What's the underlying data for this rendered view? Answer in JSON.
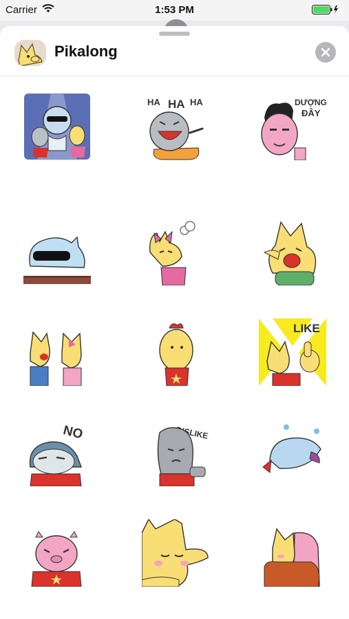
{
  "status_bar": {
    "carrier": "Carrier",
    "time": "1:53 PM",
    "wifi_icon": "wifi-icon",
    "battery_icon": "battery-charging-icon"
  },
  "header": {
    "app_name": "Pikalong",
    "app_icon": "pikalong-app-icon",
    "close_icon": "close-icon"
  },
  "stickers": [
    {
      "name": "disco-dance-sticker"
    },
    {
      "name": "laughing-sticker",
      "caption": [
        "HA",
        "HA",
        "HA"
      ]
    },
    {
      "name": "pink-man-sticker",
      "caption": [
        "DƯỢNG",
        "ĐÂY"
      ]
    },
    {
      "name": "shark-sunglasses-sticker"
    },
    {
      "name": "angry-bow-sticker"
    },
    {
      "name": "crying-sticker"
    },
    {
      "name": "shouting-sticker"
    },
    {
      "name": "chicken-sticker"
    },
    {
      "name": "like-sticker",
      "caption": [
        "LIKE"
      ]
    },
    {
      "name": "no-sticker",
      "caption": [
        "NO"
      ]
    },
    {
      "name": "dislike-sticker",
      "caption": [
        "DISLIKE"
      ]
    },
    {
      "name": "dolphin-sticker"
    },
    {
      "name": "pig-sticker"
    },
    {
      "name": "yellow-closeup-sticker"
    },
    {
      "name": "hug-sticker"
    }
  ],
  "colors": {
    "sheet": "#ffffff",
    "yellow": "#f8de74",
    "red_shirt": "#d9332c",
    "close_button": "#b6b6bb"
  }
}
